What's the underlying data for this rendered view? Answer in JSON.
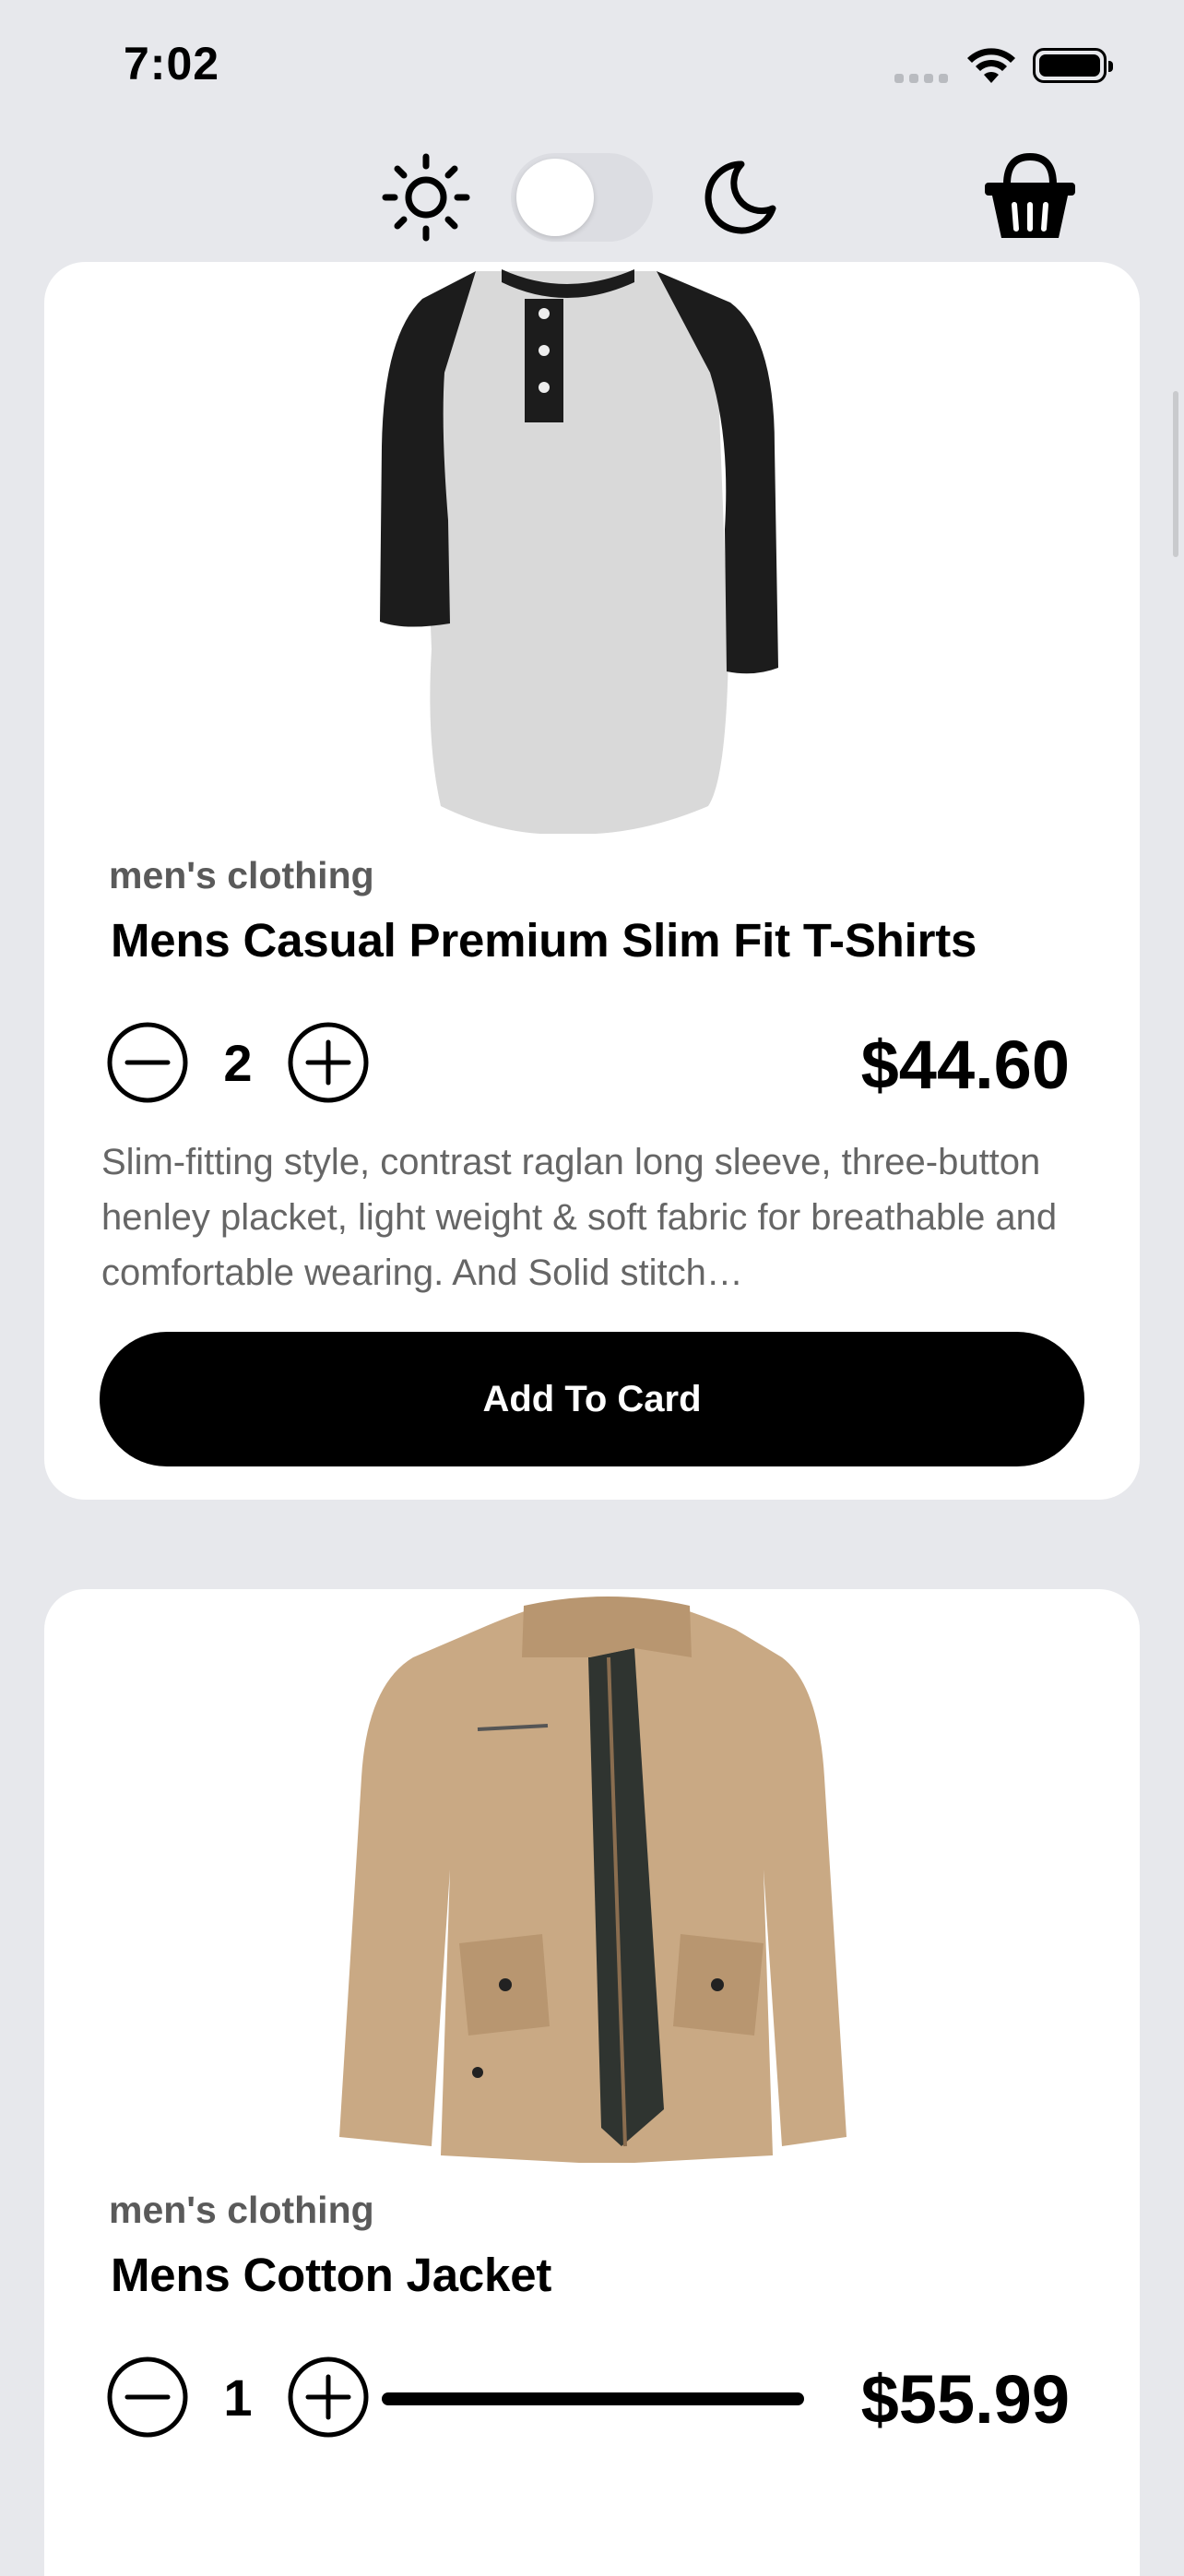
{
  "status_bar": {
    "time": "7:02"
  },
  "toolbar": {
    "light_icon": "sun-icon",
    "dark_icon": "moon-icon",
    "cart_icon": "basket-icon",
    "toggle_state": "off"
  },
  "products": [
    {
      "category": "men's clothing",
      "title": "Mens Casual Premium Slim Fit T-Shirts",
      "quantity": "2",
      "price": "$44.60",
      "description": "Slim-fitting style, contrast raglan long sleeve, three-button henley placket, light weight & soft fabric for breathable and comfortable wearing. And Solid stitch…",
      "button_label": "Add To Card",
      "image_alt": "raglan henley t-shirt"
    },
    {
      "category": "men's clothing",
      "title": "Mens Cotton Jacket",
      "quantity": "1",
      "price": "$55.99",
      "image_alt": "khaki cotton jacket"
    }
  ],
  "colors": {
    "background": "#e7e8ec",
    "card": "#ffffff",
    "button": "#000000",
    "muted_text": "#666666"
  }
}
